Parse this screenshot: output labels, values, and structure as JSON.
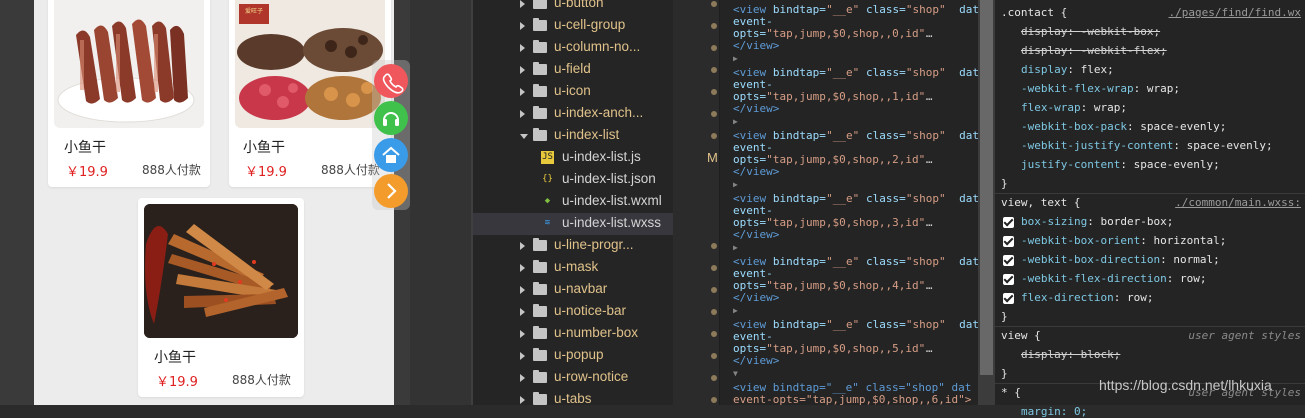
{
  "simulator": {
    "products": [
      {
        "name": "小鱼干",
        "price": "￥19.9",
        "sold": "888人付款"
      },
      {
        "name": "小鱼干",
        "price": "￥19.9",
        "sold": "888人付款"
      },
      {
        "name": "小鱼干",
        "price": "￥19.9",
        "sold": "888人付款"
      }
    ],
    "product_logo_text": "爱旺子",
    "fab_buttons": [
      {
        "icon": "phone-icon",
        "color": "#f0575c"
      },
      {
        "icon": "headset-icon",
        "color": "#3fc14b"
      },
      {
        "icon": "home-icon",
        "color": "#3a9be8"
      },
      {
        "icon": "chevron-right-icon",
        "color": "#f39c2c"
      }
    ]
  },
  "file_tree": {
    "items": [
      {
        "label": "u-button",
        "type": "folder",
        "state": "collapsed"
      },
      {
        "label": "u-cell-group",
        "type": "folder",
        "state": "collapsed"
      },
      {
        "label": "u-column-no...",
        "type": "folder",
        "state": "collapsed"
      },
      {
        "label": "u-field",
        "type": "folder",
        "state": "collapsed"
      },
      {
        "label": "u-icon",
        "type": "folder",
        "state": "collapsed"
      },
      {
        "label": "u-index-anch...",
        "type": "folder",
        "state": "collapsed"
      },
      {
        "label": "u-index-list",
        "type": "folder",
        "state": "expanded"
      },
      {
        "label": "u-index-list.js",
        "type": "js",
        "badge": "M"
      },
      {
        "label": "u-index-list.json",
        "type": "json"
      },
      {
        "label": "u-index-list.wxml",
        "type": "wxml"
      },
      {
        "label": "u-index-list.wxss",
        "type": "wxss",
        "selected": true
      },
      {
        "label": "u-line-progr...",
        "type": "folder",
        "state": "collapsed"
      },
      {
        "label": "u-mask",
        "type": "folder",
        "state": "collapsed"
      },
      {
        "label": "u-navbar",
        "type": "folder",
        "state": "collapsed"
      },
      {
        "label": "u-notice-bar",
        "type": "folder",
        "state": "collapsed"
      },
      {
        "label": "u-number-box",
        "type": "folder",
        "state": "collapsed"
      },
      {
        "label": "u-popup",
        "type": "folder",
        "state": "collapsed"
      },
      {
        "label": "u-row-notice",
        "type": "folder",
        "state": "collapsed"
      },
      {
        "label": "u-tabs",
        "type": "folder",
        "state": "collapsed"
      }
    ]
  },
  "wxml": {
    "nodes": [
      {
        "open": "<view",
        "a1": "bindtap=",
        "v1": "\"__e\"",
        "a2": "class=",
        "v2": "\"shop\"",
        "a3": "dat",
        "cont": "event-",
        "opts_attr": "opts=",
        "opts_val": "\"tap,jump,$0,shop,,0,id\"",
        "close": "</view>"
      },
      {
        "open": "<view",
        "a1": "bindtap=",
        "v1": "\"__e\"",
        "a2": "class=",
        "v2": "\"shop\"",
        "a3": "dat",
        "cont": "event-",
        "opts_attr": "opts=",
        "opts_val": "\"tap,jump,$0,shop,,1,id\"",
        "close": "</view>"
      },
      {
        "open": "<view",
        "a1": "bindtap=",
        "v1": "\"__e\"",
        "a2": "class=",
        "v2": "\"shop\"",
        "a3": "dat",
        "cont": "event-",
        "opts_attr": "opts=",
        "opts_val": "\"tap,jump,$0,shop,,2,id\"",
        "close": "</view>"
      },
      {
        "open": "<view",
        "a1": "bindtap=",
        "v1": "\"__e\"",
        "a2": "class=",
        "v2": "\"shop\"",
        "a3": "dat",
        "cont": "event-",
        "opts_attr": "opts=",
        "opts_val": "\"tap,jump,$0,shop,,3,id\"",
        "close": "</view>"
      },
      {
        "open": "<view",
        "a1": "bindtap=",
        "v1": "\"__e\"",
        "a2": "class=",
        "v2": "\"shop\"",
        "a3": "dat",
        "cont": "event-",
        "opts_attr": "opts=",
        "opts_val": "\"tap,jump,$0,shop,,4,id\"",
        "close": "</view>"
      },
      {
        "open": "<view",
        "a1": "bindtap=",
        "v1": "\"__e\"",
        "a2": "class=",
        "v2": "\"shop\"",
        "a3": "dat",
        "cont": "event-",
        "opts_attr": "opts=",
        "opts_val": "\"tap,jump,$0,shop,,5,id\"",
        "close": "</view>"
      }
    ],
    "last_line1": "<view bindtap=\"__e\" class=\"shop\" dat",
    "last_line2": "event-opts=\"tap,jump,$0,shop,,6,id\">",
    "ellipsis": "…"
  },
  "styles": {
    "contact_selector": ".contact {",
    "contact_source": "./pages/find/find.wx",
    "contact_props": [
      {
        "name": "display",
        "value": "-webkit-box;",
        "struck": true
      },
      {
        "name": "display",
        "value": "-webkit-flex;",
        "struck": true
      },
      {
        "name": "display",
        "value": "flex;"
      },
      {
        "name": "-webkit-flex-wrap",
        "value": "wrap;"
      },
      {
        "name": "flex-wrap",
        "value": "wrap;"
      },
      {
        "name": "-webkit-box-pack",
        "value": "space-evenly;"
      },
      {
        "name": "-webkit-justify-content",
        "value": "space-evenly;"
      },
      {
        "name": "justify-content",
        "value": "space-evenly;"
      }
    ],
    "close_brace": "}",
    "vt_selector": "view, text {",
    "vt_source": "./common/main.wxss:",
    "vt_props": [
      {
        "name": "box-sizing",
        "value": "border-box;"
      },
      {
        "name": "-webkit-box-orient",
        "value": "horizontal;"
      },
      {
        "name": "-webkit-box-direction",
        "value": "normal;"
      },
      {
        "name": "-webkit-flex-direction",
        "value": "row;"
      },
      {
        "name": "flex-direction",
        "value": "row;"
      }
    ],
    "view_selector": "view {",
    "view_source": "user agent styles",
    "view_props": [
      {
        "name": "display",
        "value": "block;",
        "struck": true
      }
    ],
    "star_selector": "* {",
    "star_source": "user agent styles",
    "star_partial": "margin: 0;"
  },
  "watermark": "https://blog.csdn.net/lhkuxia"
}
